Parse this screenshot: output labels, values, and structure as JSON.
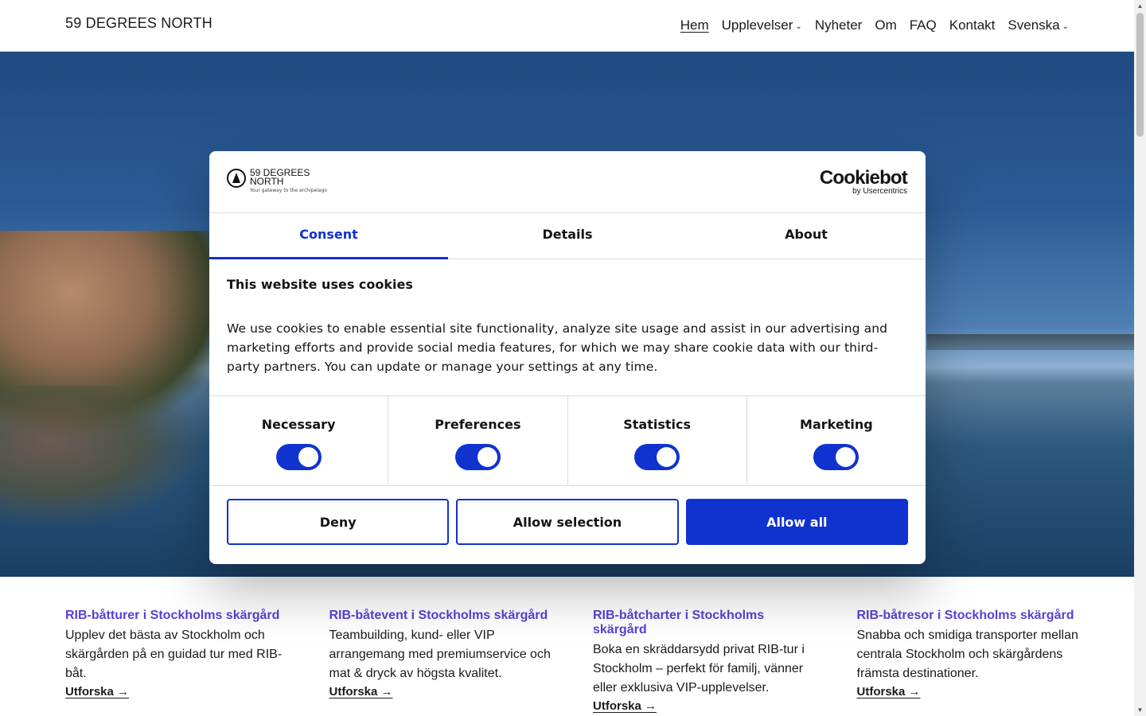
{
  "header": {
    "brand": "59 DEGREES NORTH",
    "nav": [
      {
        "label": "Hem"
      },
      {
        "label": "Upplevelser"
      },
      {
        "label": "Nyheter"
      },
      {
        "label": "Om"
      },
      {
        "label": "FAQ"
      },
      {
        "label": "Kontakt"
      },
      {
        "label": "Svenska"
      }
    ]
  },
  "cookie_dialog": {
    "logo": {
      "name": "59 DEGREES",
      "name2": "NORTH",
      "tagline": "Your gateway to the archipelago"
    },
    "provider": {
      "name": "Cookiebot",
      "by": "by Usercentrics"
    },
    "tabs": [
      {
        "label": "Consent"
      },
      {
        "label": "Details"
      },
      {
        "label": "About"
      }
    ],
    "heading": "This website uses cookies",
    "body": "We use cookies to enable essential site functionality, analyze site usage and assist in our advertising and marketing efforts and provide social media features, for which we may share cookie data with our third-party partners. You can update or manage your settings at any time.",
    "categories": [
      {
        "label": "Necessary",
        "enabled": true
      },
      {
        "label": "Preferences",
        "enabled": true
      },
      {
        "label": "Statistics",
        "enabled": true
      },
      {
        "label": "Marketing",
        "enabled": true
      }
    ],
    "buttons": {
      "deny": "Deny",
      "allow_selection": "Allow selection",
      "allow_all": "Allow all"
    },
    "accent_color": "#1032cf"
  },
  "cards": [
    {
      "title": "RIB-båtturer i Stockholms skärgård",
      "text": "Upplev det bästa av Stockholm och skärgården på en guidad tur med RIB-båt.",
      "link": "Utforska →"
    },
    {
      "title": "RIB-båtevent i Stockholms skärgård",
      "text": "Teambuilding, kund- eller VIP arrangemang med premiumservice och mat & dryck av högsta kvalitet.",
      "link": "Utforska →"
    },
    {
      "title": "RIB-båtcharter i Stockholms skärgård",
      "text": "Boka en skräddarsydd privat RIB-tur i Stockholm – perfekt för familj, vänner eller exklusiva VIP-upplevelser.",
      "link": "Utforska →"
    },
    {
      "title": "RIB-båtresor i Stockholms skärgård",
      "text": "Snabba och smidiga transporter mellan centrala Stockholm och skärgårdens främsta destinationer.",
      "link": "Utforska →"
    }
  ],
  "colors": {
    "card_title": "#5a3fd6"
  }
}
